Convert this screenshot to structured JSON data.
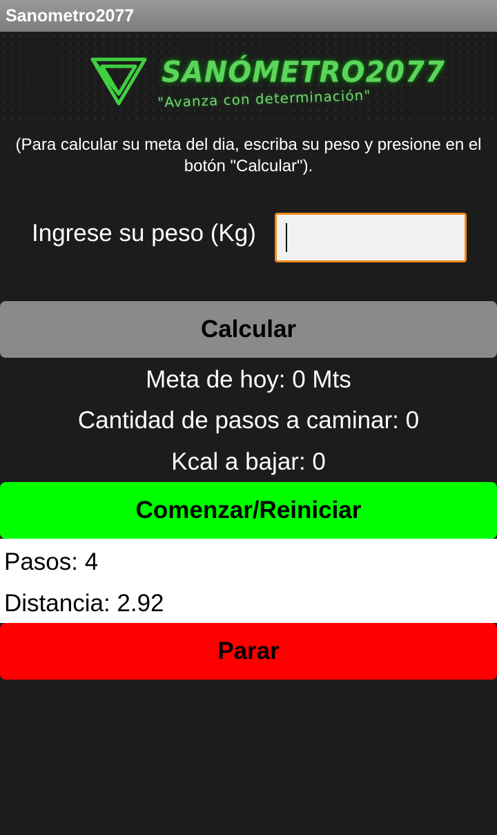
{
  "app": {
    "title": "Sanometro2077"
  },
  "logo": {
    "title": "SANÓMETRO2077",
    "slogan": "\"Avanza con determinación\""
  },
  "instructions": "(Para calcular su meta del dia, escriba su peso y presione en el botón \"Calcular\").",
  "weight": {
    "label": "Ingrese su peso (Kg)",
    "value": "",
    "placeholder": ""
  },
  "buttons": {
    "calculate": "Calcular",
    "start": "Comenzar/Reiniciar",
    "stop": "Parar"
  },
  "results": {
    "goal": "Meta de hoy:  0 Mts",
    "steps_to_walk": "Cantidad de pasos a caminar: 0",
    "kcal": "Kcal a bajar: 0"
  },
  "tracker": {
    "steps": "Pasos: 4",
    "distance": "Distancia: 2.92"
  },
  "colors": {
    "background": "#1c1c1c",
    "accent_green": "#00ff00",
    "stop_red": "#ff0000",
    "input_border": "#f28c1c",
    "logo_green": "#5bd55b"
  }
}
